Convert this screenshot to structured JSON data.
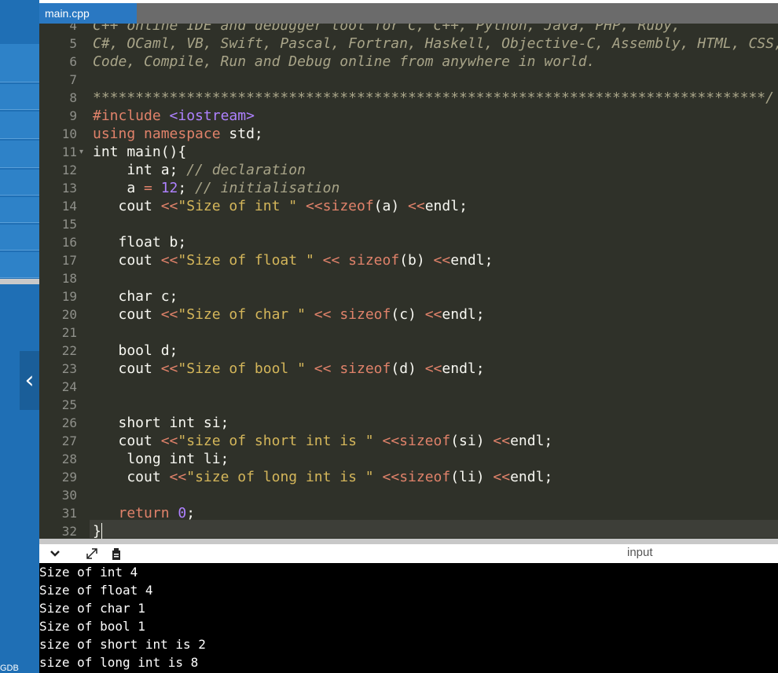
{
  "tab": {
    "filename": "main.cpp"
  },
  "sidebar": {
    "collapse_glyph": "‹",
    "bottom_label": "GDB"
  },
  "editor": {
    "lines": [
      {
        "n": "4",
        "segs": [
          {
            "c": "comment",
            "t": "C++ online IDE and debugger tool for C, C++, Python, Java, PHP, Ruby,"
          }
        ]
      },
      {
        "n": "5",
        "segs": [
          {
            "c": "comment",
            "t": "C#, OCaml, VB, Swift, Pascal, Fortran, Haskell, Objective-C, Assembly, HTML, CSS, JS, SQLite, Prolog."
          }
        ]
      },
      {
        "n": "6",
        "segs": [
          {
            "c": "comment",
            "t": "Code, Compile, Run and Debug online from anywhere in world."
          }
        ]
      },
      {
        "n": "7",
        "segs": []
      },
      {
        "n": "8",
        "segs": [
          {
            "c": "comment",
            "t": "*******************************************************************************/"
          }
        ]
      },
      {
        "n": "9",
        "segs": [
          {
            "c": "kw",
            "t": "#include "
          },
          {
            "c": "num",
            "t": "<iostream>"
          }
        ]
      },
      {
        "n": "10",
        "segs": [
          {
            "c": "kw",
            "t": "using namespace "
          },
          {
            "c": "",
            "t": "std;"
          }
        ]
      },
      {
        "n": "11",
        "fold": true,
        "segs": [
          {
            "c": "",
            "t": "int main(){"
          }
        ]
      },
      {
        "n": "12",
        "segs": [
          {
            "c": "",
            "t": "    int a; "
          },
          {
            "c": "comment",
            "t": "// declaration"
          }
        ]
      },
      {
        "n": "13",
        "segs": [
          {
            "c": "",
            "t": "    a "
          },
          {
            "c": "kw",
            "t": "= "
          },
          {
            "c": "num",
            "t": "12"
          },
          {
            "c": "",
            "t": "; "
          },
          {
            "c": "comment",
            "t": "// initialisation"
          }
        ]
      },
      {
        "n": "14",
        "segs": [
          {
            "c": "",
            "t": "   cout "
          },
          {
            "c": "kw",
            "t": "<<"
          },
          {
            "c": "str",
            "t": "\"Size of int \""
          },
          {
            "c": "",
            "t": " "
          },
          {
            "c": "kw",
            "t": "<<"
          },
          {
            "c": "fn",
            "t": "sizeof"
          },
          {
            "c": "",
            "t": "(a) "
          },
          {
            "c": "kw",
            "t": "<<"
          },
          {
            "c": "",
            "t": "endl;"
          }
        ]
      },
      {
        "n": "15",
        "segs": []
      },
      {
        "n": "16",
        "segs": [
          {
            "c": "",
            "t": "   float b;"
          }
        ]
      },
      {
        "n": "17",
        "segs": [
          {
            "c": "",
            "t": "   cout "
          },
          {
            "c": "kw",
            "t": "<<"
          },
          {
            "c": "str",
            "t": "\"Size of float \""
          },
          {
            "c": "",
            "t": " "
          },
          {
            "c": "kw",
            "t": "<<"
          },
          {
            "c": "",
            "t": " "
          },
          {
            "c": "fn",
            "t": "sizeof"
          },
          {
            "c": "",
            "t": "(b) "
          },
          {
            "c": "kw",
            "t": "<<"
          },
          {
            "c": "",
            "t": "endl;"
          }
        ]
      },
      {
        "n": "18",
        "segs": []
      },
      {
        "n": "19",
        "segs": [
          {
            "c": "",
            "t": "   char c;"
          }
        ]
      },
      {
        "n": "20",
        "segs": [
          {
            "c": "",
            "t": "   cout "
          },
          {
            "c": "kw",
            "t": "<<"
          },
          {
            "c": "str",
            "t": "\"Size of char \""
          },
          {
            "c": "",
            "t": " "
          },
          {
            "c": "kw",
            "t": "<<"
          },
          {
            "c": "",
            "t": " "
          },
          {
            "c": "fn",
            "t": "sizeof"
          },
          {
            "c": "",
            "t": "(c) "
          },
          {
            "c": "kw",
            "t": "<<"
          },
          {
            "c": "",
            "t": "endl;"
          }
        ]
      },
      {
        "n": "21",
        "segs": []
      },
      {
        "n": "22",
        "segs": [
          {
            "c": "",
            "t": "   bool d;"
          }
        ]
      },
      {
        "n": "23",
        "segs": [
          {
            "c": "",
            "t": "   cout "
          },
          {
            "c": "kw",
            "t": "<<"
          },
          {
            "c": "str",
            "t": "\"Size of bool \""
          },
          {
            "c": "",
            "t": " "
          },
          {
            "c": "kw",
            "t": "<<"
          },
          {
            "c": "",
            "t": " "
          },
          {
            "c": "fn",
            "t": "sizeof"
          },
          {
            "c": "",
            "t": "(d) "
          },
          {
            "c": "kw",
            "t": "<<"
          },
          {
            "c": "",
            "t": "endl;"
          }
        ]
      },
      {
        "n": "24",
        "segs": []
      },
      {
        "n": "25",
        "segs": []
      },
      {
        "n": "26",
        "segs": [
          {
            "c": "",
            "t": "   short int si;"
          }
        ]
      },
      {
        "n": "27",
        "segs": [
          {
            "c": "",
            "t": "   cout "
          },
          {
            "c": "kw",
            "t": "<<"
          },
          {
            "c": "str",
            "t": "\"size of short int is \""
          },
          {
            "c": "",
            "t": " "
          },
          {
            "c": "kw",
            "t": "<<"
          },
          {
            "c": "fn",
            "t": "sizeof"
          },
          {
            "c": "",
            "t": "(si) "
          },
          {
            "c": "kw",
            "t": "<<"
          },
          {
            "c": "",
            "t": "endl;"
          }
        ]
      },
      {
        "n": "28",
        "segs": [
          {
            "c": "",
            "t": "    long int li;"
          }
        ]
      },
      {
        "n": "29",
        "segs": [
          {
            "c": "",
            "t": "    cout "
          },
          {
            "c": "kw",
            "t": "<<"
          },
          {
            "c": "str",
            "t": "\"size of long int is \""
          },
          {
            "c": "",
            "t": " "
          },
          {
            "c": "kw",
            "t": "<<"
          },
          {
            "c": "fn",
            "t": "sizeof"
          },
          {
            "c": "",
            "t": "(li) "
          },
          {
            "c": "kw",
            "t": "<<"
          },
          {
            "c": "",
            "t": "endl;"
          }
        ]
      },
      {
        "n": "30",
        "segs": []
      },
      {
        "n": "31",
        "segs": [
          {
            "c": "kw",
            "t": "   return "
          },
          {
            "c": "num",
            "t": "0"
          },
          {
            "c": "",
            "t": ";"
          }
        ]
      },
      {
        "n": "32",
        "segs": [
          {
            "c": "",
            "t": "}"
          }
        ]
      }
    ]
  },
  "io": {
    "input_label": "input",
    "output_lines": [
      "Size of int 4",
      "Size of float 4",
      "Size of char 1",
      "Size of bool 1",
      "size of short int is 2",
      "size of long int is 8"
    ]
  },
  "colors": {
    "sidebar": "#1f6fb5",
    "tab_active": "#2a78c2",
    "editor_bg": "#2f3129",
    "output_bg": "#000000"
  },
  "icons": {
    "collapse": "chevron-down-icon",
    "expand": "expand-icon",
    "copy": "copy-icon"
  }
}
